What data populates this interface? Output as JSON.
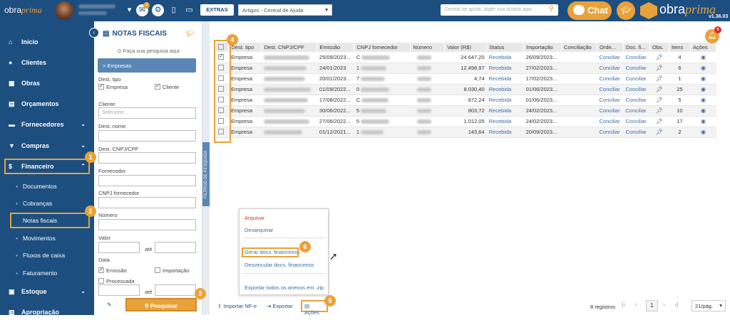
{
  "topbar": {
    "logo_text": "obra",
    "logo_accent": "prima",
    "notif_count": "2",
    "extras_label": "EXTRAS",
    "article_select": "Artigos - Central de Ajuda",
    "search_placeholder": "Central de ajuda: digite sua dúvida aqui",
    "chat_label": "Chat",
    "brand_text": "obra",
    "brand_accent": "prima",
    "version": "v1.36.03"
  },
  "sidebar": {
    "items": [
      {
        "label": "Início",
        "icon": "home-icon"
      },
      {
        "label": "Clientes",
        "icon": "user-icon"
      },
      {
        "label": "Obras",
        "icon": "building-icon"
      },
      {
        "label": "Orçamentos",
        "icon": "calculator-icon"
      },
      {
        "label": "Fornecedores",
        "icon": "truck-icon"
      },
      {
        "label": "Compras",
        "icon": "cart-icon"
      },
      {
        "label": "Financeiro",
        "icon": "dollar-icon"
      },
      {
        "label": "Estoque",
        "icon": "box-icon"
      },
      {
        "label": "Apropriação",
        "icon": "chart-icon"
      }
    ],
    "sub_items": [
      "Documentos",
      "Cobranças",
      "Notas fiscais",
      "Movimentos",
      "Fluxos de caixa",
      "Faturamento"
    ]
  },
  "filter": {
    "title": "NOTAS FISCAIS",
    "hint": "Faça sua pesquisa aqui",
    "empresas_label": "> Empresas",
    "dest_tipo_label": "Dest. tipo",
    "opt_empresa": "Empresa",
    "opt_cliente": "Cliente",
    "cliente_label": "Cliente",
    "cliente_placeholder": "Selecione...",
    "dest_nome_label": "Dest. nome",
    "dest_cnpj_label": "Dest. CNPJ/CPF",
    "fornecedor_label": "Fornecedor",
    "cnpj_fornecedor_label": "CNPJ fornecedor",
    "numero_label": "Número",
    "valor_label": "Valor",
    "ate_label": "até",
    "data_label": "Data",
    "opt_emissao": "Emissão",
    "opt_importacao": "Importação",
    "opt_processada": "Processada",
    "ate2_label": "até",
    "search_button": "Pesquisar",
    "side_tab": "FILTROS DE PESQUISA"
  },
  "table": {
    "headers": [
      "Dest. tipo",
      "Dest. CNPJ/CPF",
      "Emissão",
      "CNPJ fornecedor",
      "Número",
      "Valor (R$)",
      "Status",
      "Importação",
      "Conciliação",
      "Orde...",
      "Doc. fi...",
      "Obs.",
      "Itens",
      "Ações"
    ],
    "rows": [
      {
        "tipo": "Empresa",
        "emissao": "25/09/2023...",
        "cnpj_f": "C",
        "valor": "24.647,20",
        "status": "Recebida",
        "importacao": "26/09/2023...",
        "ordem": "Conciliar",
        "doc": "Conciliar",
        "itens": "4",
        "checked": true
      },
      {
        "tipo": "Empresa",
        "emissao": "24/01/2023",
        "cnpj_f": "1",
        "valor": "12.498,97",
        "status": "Recebida",
        "importacao": "27/02/2023...",
        "ordem": "Conciliar",
        "doc": "Conciliar",
        "itens": "6",
        "checked": false
      },
      {
        "tipo": "Empresa",
        "emissao": "20/01/2023...",
        "cnpj_f": "7",
        "valor": "4,74",
        "status": "Recebida",
        "importacao": "17/02/2023...",
        "ordem": "Conciliar",
        "doc": "Conciliar",
        "itens": "1",
        "checked": false
      },
      {
        "tipo": "Empresa",
        "emissao": "01/09/2022...",
        "cnpj_f": "0",
        "valor": "8.030,40",
        "status": "Recebida",
        "importacao": "01/06/2023...",
        "ordem": "Conciliar",
        "doc": "Conciliar",
        "itens": "25",
        "checked": false
      },
      {
        "tipo": "Empresa",
        "emissao": "17/08/2022...",
        "cnpj_f": "C",
        "valor": "672,24",
        "status": "Recebida",
        "importacao": "01/06/2023...",
        "ordem": "Conciliar",
        "doc": "Conciliar",
        "itens": "5",
        "checked": false
      },
      {
        "tipo": "Empresa",
        "emissao": "30/06/2022...",
        "cnpj_f": "5",
        "valor": "803,72",
        "status": "Recebida",
        "importacao": "24/02/2023...",
        "ordem": "Conciliar",
        "doc": "Conciliar",
        "itens": "10",
        "checked": false
      },
      {
        "tipo": "Empresa",
        "emissao": "27/06/2022...",
        "cnpj_f": "5",
        "valor": "1.012,05",
        "status": "Recebida",
        "importacao": "24/02/2023...",
        "ordem": "Conciliar",
        "doc": "Conciliar",
        "itens": "17",
        "checked": false
      },
      {
        "tipo": "Empresa",
        "emissao": "01/12/2021...",
        "cnpj_f": "1",
        "valor": "143,64",
        "status": "Recebida",
        "importacao": "20/09/2023...",
        "ordem": "Conciliar",
        "doc": "Conciliar",
        "itens": "2",
        "checked": false
      }
    ]
  },
  "bell_count": "6",
  "actions_menu": {
    "items": [
      "Arquivar",
      "Desarquivar",
      "Gerar docs. financeiros",
      "Desvincular docs. financeiros",
      "Exportar todos os anexos em .zip"
    ]
  },
  "footer": {
    "import_label": "Importar NF-e",
    "export_label": "Exportar",
    "actions_label": "Ações",
    "records": "8 registros",
    "page": "1",
    "per_page": "21/pág."
  },
  "badges": [
    "1",
    "2",
    "3",
    "4",
    "5",
    "6"
  ],
  "colors": {
    "primary": "#1c4e80",
    "accent": "#e8a23a",
    "link": "#3b6ea8",
    "danger": "#d9322b"
  }
}
